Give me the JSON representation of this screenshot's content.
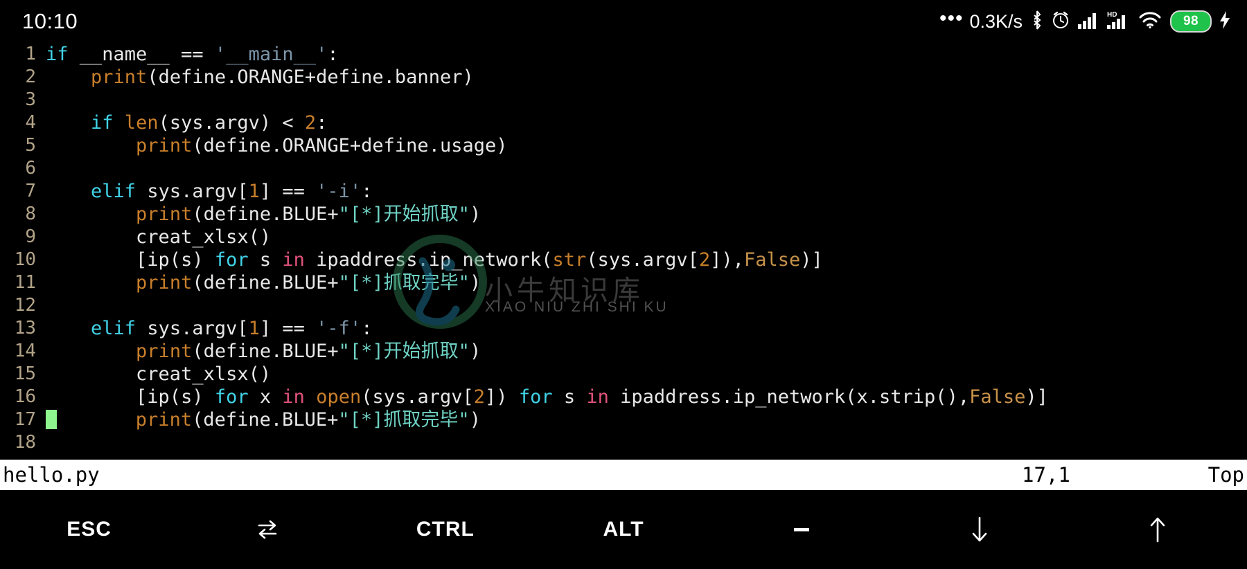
{
  "status_bar": {
    "clock": "10:10",
    "network_speed": "0.3K/s",
    "battery_level": "98",
    "icons": [
      "more-dots-icon",
      "bluetooth-icon",
      "alarm-clock-icon",
      "signal-bars-icon",
      "hd-signal-icon",
      "wifi-icon",
      "battery-icon",
      "charging-bolt-icon"
    ],
    "battery_color": "#1fc24a"
  },
  "editor": {
    "app": "vim",
    "lines": [
      {
        "n": "1",
        "tokens": [
          {
            "t": "if",
            "c": "kw"
          },
          {
            "t": " __name__ == ",
            "c": "plain"
          },
          {
            "t": "'__main__'",
            "c": "str"
          },
          {
            "t": ":",
            "c": "plain"
          }
        ]
      },
      {
        "n": "2",
        "tokens": [
          {
            "t": "    ",
            "c": "plain"
          },
          {
            "t": "print",
            "c": "fn"
          },
          {
            "t": "(define.ORANGE+define.banner)",
            "c": "plain"
          }
        ]
      },
      {
        "n": "3",
        "tokens": []
      },
      {
        "n": "4",
        "tokens": [
          {
            "t": "    ",
            "c": "plain"
          },
          {
            "t": "if",
            "c": "kw"
          },
          {
            "t": " ",
            "c": "plain"
          },
          {
            "t": "len",
            "c": "fn"
          },
          {
            "t": "(sys.argv) < ",
            "c": "plain"
          },
          {
            "t": "2",
            "c": "num"
          },
          {
            "t": ":",
            "c": "plain"
          }
        ]
      },
      {
        "n": "5",
        "tokens": [
          {
            "t": "        ",
            "c": "plain"
          },
          {
            "t": "print",
            "c": "fn"
          },
          {
            "t": "(define.ORANGE+define.usage)",
            "c": "plain"
          }
        ]
      },
      {
        "n": "6",
        "tokens": []
      },
      {
        "n": "7",
        "tokens": [
          {
            "t": "    ",
            "c": "plain"
          },
          {
            "t": "elif",
            "c": "kw"
          },
          {
            "t": " sys.argv[",
            "c": "plain"
          },
          {
            "t": "1",
            "c": "num"
          },
          {
            "t": "] == ",
            "c": "plain"
          },
          {
            "t": "'-i'",
            "c": "str"
          },
          {
            "t": ":",
            "c": "plain"
          }
        ]
      },
      {
        "n": "8",
        "tokens": [
          {
            "t": "        ",
            "c": "plain"
          },
          {
            "t": "print",
            "c": "fn"
          },
          {
            "t": "(define.BLUE+",
            "c": "plain"
          },
          {
            "t": "\"[*]开始抓取\"",
            "c": "str2"
          },
          {
            "t": ")",
            "c": "plain"
          }
        ]
      },
      {
        "n": "9",
        "tokens": [
          {
            "t": "        creat_xlsx()",
            "c": "plain"
          }
        ]
      },
      {
        "n": "10",
        "tokens": [
          {
            "t": "        [ip(s) ",
            "c": "plain"
          },
          {
            "t": "for",
            "c": "kw"
          },
          {
            "t": " s ",
            "c": "plain"
          },
          {
            "t": "in",
            "c": "in"
          },
          {
            "t": " ipaddress.ip_network(",
            "c": "plain"
          },
          {
            "t": "str",
            "c": "fn"
          },
          {
            "t": "(sys.argv[",
            "c": "plain"
          },
          {
            "t": "2",
            "c": "num"
          },
          {
            "t": "]),",
            "c": "plain"
          },
          {
            "t": "False",
            "c": "const"
          },
          {
            "t": ")]",
            "c": "plain"
          }
        ]
      },
      {
        "n": "11",
        "tokens": [
          {
            "t": "        ",
            "c": "plain"
          },
          {
            "t": "print",
            "c": "fn"
          },
          {
            "t": "(define.BLUE+",
            "c": "plain"
          },
          {
            "t": "\"[*]抓取完毕\"",
            "c": "str2"
          },
          {
            "t": ")",
            "c": "plain"
          }
        ]
      },
      {
        "n": "12",
        "tokens": []
      },
      {
        "n": "13",
        "tokens": [
          {
            "t": "    ",
            "c": "plain"
          },
          {
            "t": "elif",
            "c": "kw"
          },
          {
            "t": " sys.argv[",
            "c": "plain"
          },
          {
            "t": "1",
            "c": "num"
          },
          {
            "t": "] == ",
            "c": "plain"
          },
          {
            "t": "'-f'",
            "c": "str"
          },
          {
            "t": ":",
            "c": "plain"
          }
        ]
      },
      {
        "n": "14",
        "tokens": [
          {
            "t": "        ",
            "c": "plain"
          },
          {
            "t": "print",
            "c": "fn"
          },
          {
            "t": "(define.BLUE+",
            "c": "plain"
          },
          {
            "t": "\"[*]开始抓取\"",
            "c": "str2"
          },
          {
            "t": ")",
            "c": "plain"
          }
        ]
      },
      {
        "n": "15",
        "tokens": [
          {
            "t": "        creat_xlsx()",
            "c": "plain"
          }
        ]
      },
      {
        "n": "16",
        "tokens": [
          {
            "t": "        [ip(s) ",
            "c": "plain"
          },
          {
            "t": "for",
            "c": "kw"
          },
          {
            "t": " x ",
            "c": "plain"
          },
          {
            "t": "in",
            "c": "in"
          },
          {
            "t": " ",
            "c": "plain"
          },
          {
            "t": "open",
            "c": "fn"
          },
          {
            "t": "(sys.argv[",
            "c": "plain"
          },
          {
            "t": "2",
            "c": "num"
          },
          {
            "t": "]) ",
            "c": "plain"
          },
          {
            "t": "for",
            "c": "kw"
          },
          {
            "t": " s ",
            "c": "plain"
          },
          {
            "t": "in",
            "c": "in"
          },
          {
            "t": " ipaddress.ip_network(x.strip(),",
            "c": "plain"
          },
          {
            "t": "False",
            "c": "const"
          },
          {
            "t": ")]",
            "c": "plain"
          }
        ]
      },
      {
        "n": "17",
        "tokens": [
          {
            "t": "        ",
            "c": "plain"
          },
          {
            "t": "print",
            "c": "fn"
          },
          {
            "t": "(define.BLUE+",
            "c": "plain"
          },
          {
            "t": "\"[*]抓取完毕\"",
            "c": "str2"
          },
          {
            "t": ")",
            "c": "plain"
          }
        ],
        "cursor": true
      },
      {
        "n": "18",
        "tokens": []
      }
    ]
  },
  "watermark": {
    "cn_text": "小牛知识库",
    "pinyin_text": "XIAO NIU ZHI SHI KU"
  },
  "vim_status": {
    "filename": "hello.py",
    "position": "17,1",
    "scroll": "Top"
  },
  "keybar": {
    "keys": [
      {
        "label": "ESC",
        "icon": ""
      },
      {
        "label": "",
        "icon": "tab-icon"
      },
      {
        "label": "CTRL",
        "icon": ""
      },
      {
        "label": "ALT",
        "icon": ""
      },
      {
        "label": "",
        "icon": "minus-icon"
      },
      {
        "label": "",
        "icon": "arrow-down-icon"
      },
      {
        "label": "",
        "icon": "arrow-up-icon"
      }
    ]
  }
}
